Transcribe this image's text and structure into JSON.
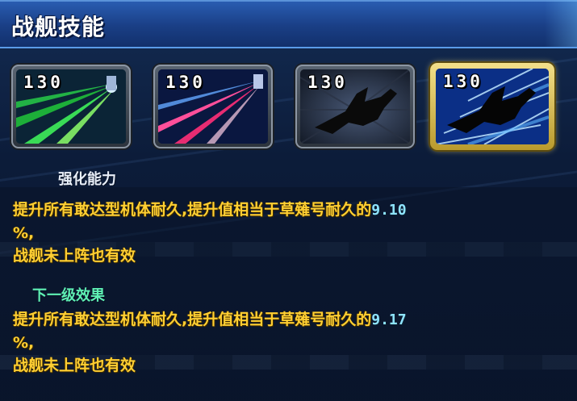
{
  "header": {
    "title": "战舰技能"
  },
  "skills": [
    {
      "level": "130",
      "icon": "green-laser-beam-icon",
      "selected": false
    },
    {
      "level": "130",
      "icon": "pink-laser-beam-icon",
      "selected": false
    },
    {
      "level": "130",
      "icon": "warship-silhouette-icon",
      "selected": false
    },
    {
      "level": "130",
      "icon": "warship-speed-boost-icon",
      "selected": true
    }
  ],
  "current": {
    "label": "强化能力",
    "line1_text": "提升所有敢达型机体耐久,提升值相当于草薙号耐久的",
    "line1_value": "9.10",
    "line2_text": "%,",
    "line3_text": "战舰未上阵也有效"
  },
  "next": {
    "label": "下一级效果",
    "line1_text": "提升所有敢达型机体耐久,提升值相当于草薙号耐久的",
    "line1_value": "9.17",
    "line2_text": "%,",
    "line3_text": "战舰未上阵也有效"
  },
  "colors": {
    "title_bar": "#1a3f86",
    "effect_text": "#ffcf33",
    "value_text": "#8fe4ff",
    "next_label": "#5ff0b4",
    "selected_frame": "#f3e08a"
  }
}
